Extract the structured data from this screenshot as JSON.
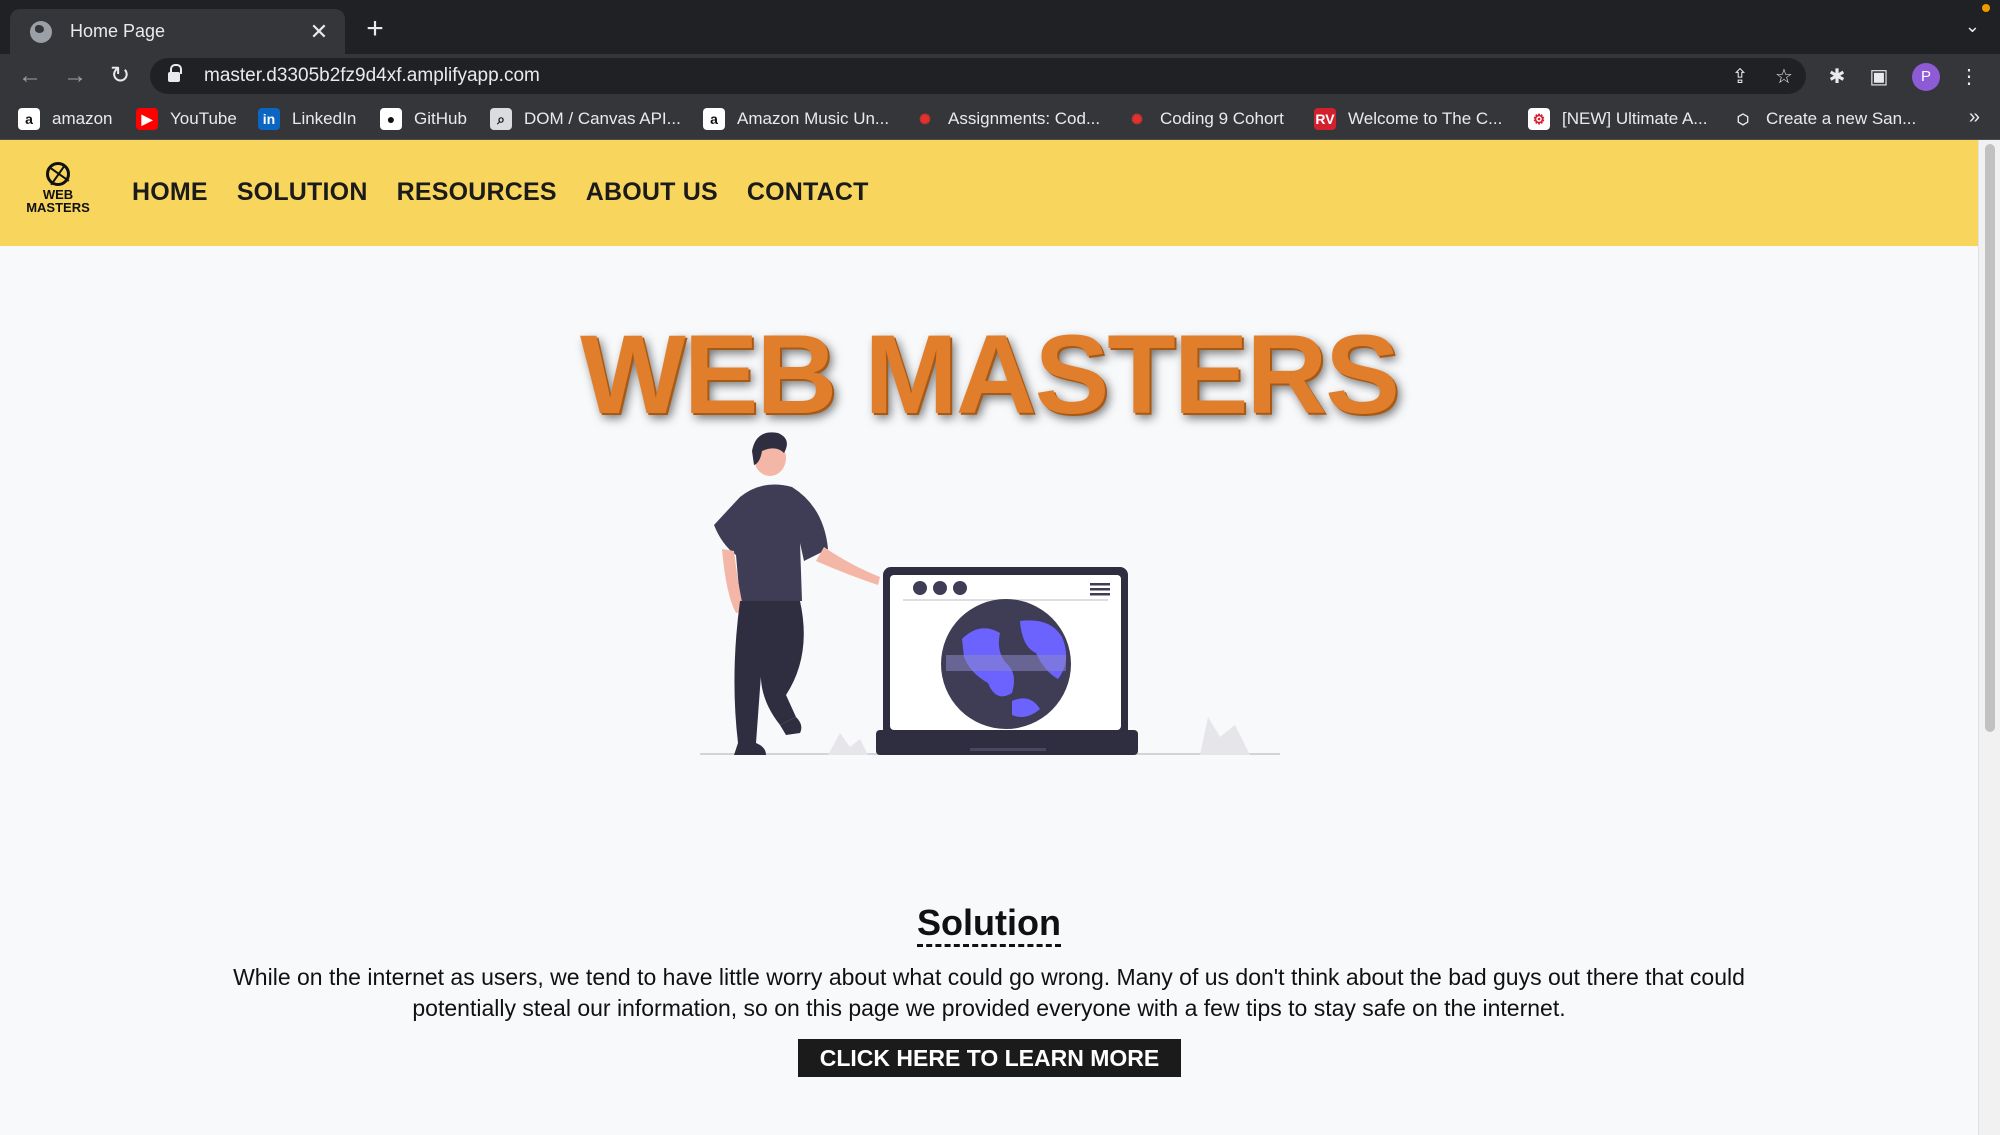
{
  "browser": {
    "tab_title": "Home Page",
    "tab_close": "✕",
    "new_tab": "+",
    "tab_menu": "⌄",
    "url": "master.d3305b2fz9d4xf.amplifyapp.com",
    "profile_initial": "P",
    "back_icon": "←",
    "forward_icon": "→",
    "reload_icon": "↻",
    "share_icon": "⇪",
    "star_icon": "☆",
    "extensions_icon": "✱",
    "sidepanel_icon": "▣",
    "menu_icon": "⋮",
    "bookmarks_more": "»"
  },
  "bookmarks": [
    {
      "label": "amazon",
      "icon": "amazon-icon",
      "glyph": "a",
      "color": "#ffffff",
      "fg": "#111111"
    },
    {
      "label": "YouTube",
      "icon": "youtube-icon",
      "glyph": "▶",
      "color": "#ff0000",
      "fg": "#ffffff"
    },
    {
      "label": "LinkedIn",
      "icon": "linkedin-icon",
      "glyph": "in",
      "color": "#0a66c2",
      "fg": "#ffffff"
    },
    {
      "label": "GitHub",
      "icon": "github-icon",
      "glyph": "●",
      "color": "#ffffff",
      "fg": "#111111"
    },
    {
      "label": "DOM / Canvas API...",
      "icon": "search-icon",
      "glyph": "⌕",
      "color": "#dadce0",
      "fg": "#111111"
    },
    {
      "label": "Amazon Music Un...",
      "icon": "amazon-icon",
      "glyph": "a",
      "color": "#ffffff",
      "fg": "#111111"
    },
    {
      "label": "Assignments: Cod...",
      "icon": "canvas-icon",
      "glyph": "✺",
      "color": "#35363a",
      "fg": "#e3312d"
    },
    {
      "label": "Coding 9 Cohort",
      "icon": "canvas-icon",
      "glyph": "✺",
      "color": "#35363a",
      "fg": "#e3312d"
    },
    {
      "label": "Welcome to The C...",
      "icon": "rv-icon",
      "glyph": "RV",
      "color": "#d3202e",
      "fg": "#ffffff"
    },
    {
      "label": "[NEW] Ultimate A...",
      "icon": "course-icon",
      "glyph": "⚙",
      "color": "#ffffff",
      "fg": "#d3202e"
    },
    {
      "label": "Create a new San...",
      "icon": "sandbox-icon",
      "glyph": "⬡",
      "color": "#35363a",
      "fg": "#e8eaed"
    }
  ],
  "site": {
    "logo_line1": "WEB",
    "logo_line2": "MASTERS",
    "nav": [
      "HOME",
      "SOLUTION",
      "RESOURCES",
      "ABOUT US",
      "CONTACT"
    ],
    "hero_title": "WEB MASTERS",
    "solution_heading": "Solution",
    "solution_text": "While on the internet as users, we tend to have little worry about what could go wrong. Many of us don't think about the bad guys out there that could potentially steal our information, so on this page we provided everyone with a few tips to stay safe on the internet.",
    "cta_label": "CLICK HERE TO LEARN MORE"
  },
  "colors": {
    "header_bg": "#f8d55c",
    "hero_title": "#e07e2c",
    "page_bg": "#f8f9fb",
    "globe_accent": "#6c63ff"
  }
}
